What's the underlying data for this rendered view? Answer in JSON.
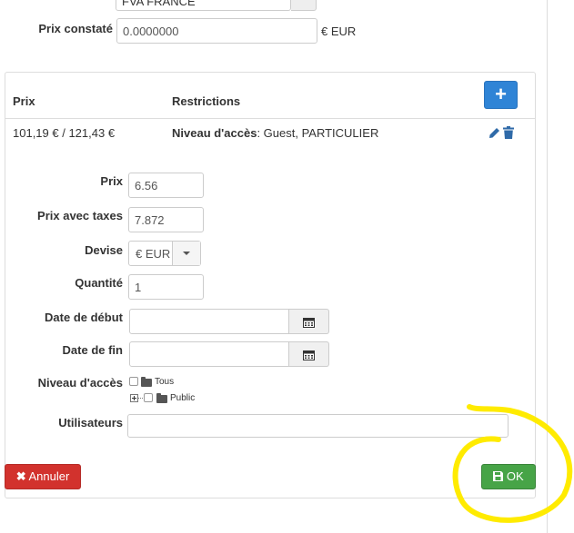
{
  "top_form": {
    "prev_select_value": "FVA FRANCE",
    "prix_constate_label": "Prix constaté",
    "prix_constate_value": "0.0000000",
    "prix_constate_unit": "€ EUR"
  },
  "table": {
    "headers": {
      "price": "Prix",
      "restrictions": "Restrictions"
    },
    "add_button_icon": "plus-icon",
    "row": {
      "price": "101,19 € / 121,43 €",
      "restriction_label": "Niveau d'accès",
      "restriction_value": ": Guest, PARTICULIER",
      "edit_icon": "pencil-icon",
      "delete_icon": "trash-icon"
    }
  },
  "edit_form": {
    "prix_label": "Prix",
    "prix_value": "6.56",
    "prix_taxes_label": "Prix avec taxes",
    "prix_taxes_value": "7.872",
    "devise_label": "Devise",
    "devise_value": "€ EUR",
    "quantite_label": "Quantité",
    "quantite_value": "1",
    "date_debut_label": "Date de début",
    "date_debut_value": "",
    "date_fin_label": "Date de fin",
    "date_fin_value": "",
    "niveau_label": "Niveau d'accès",
    "niveau_options": [
      "Tous",
      "Public"
    ],
    "utilisateurs_label": "Utilisateurs",
    "utilisateurs_value": ""
  },
  "buttons": {
    "cancel": "Annuler",
    "ok": "OK"
  },
  "colors": {
    "add_button": "#2f84d6",
    "cancel_button": "#d2322d",
    "ok_button": "#47a447",
    "highlight": "#ffeb00"
  }
}
